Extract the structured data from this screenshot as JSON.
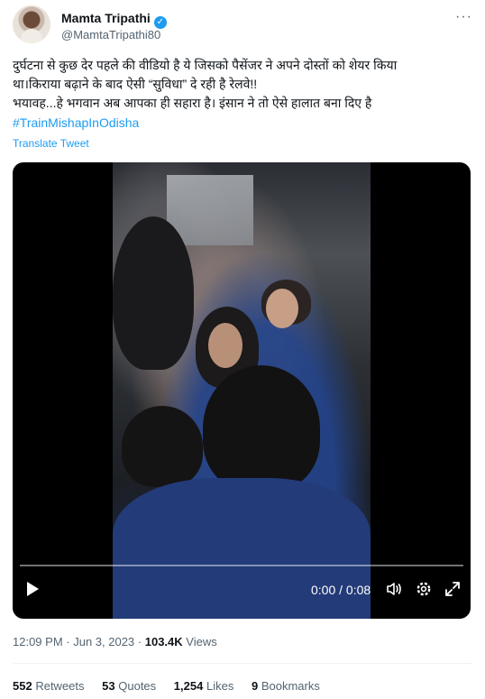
{
  "author": {
    "name": "Mamta Tripathi",
    "handle": "@MamtaTripathi80",
    "verified_badge": "✓"
  },
  "more_glyph": "···",
  "tweet": {
    "text": "दुर्घटना से कुछ देर पहले की वीडियो है ये जिसको पैसेंजर ने अपने दोस्तों को शेयर किया\nथा।किराया बढ़ाने के बाद ऐसी “सुविधा” दे रही है रेलवे!!\nभयावह...हे भगवान अब आपका ही सहारा है। इंसान ने तो ऐसे हालात बना दिए है",
    "hashtag": "#TrainMishapInOdisha",
    "translate": "Translate Tweet"
  },
  "video": {
    "time": "0:00 / 0:08",
    "progress": 0,
    "icons": [
      "play-icon",
      "volume-icon",
      "settings-icon",
      "fullscreen-icon"
    ]
  },
  "meta": {
    "time": "12:09 PM",
    "date": "Jun 3, 2023",
    "views_count": "103.4K",
    "views_label": "Views"
  },
  "stats": [
    {
      "count": "552",
      "label": "Retweets"
    },
    {
      "count": "53",
      "label": "Quotes"
    },
    {
      "count": "1,254",
      "label": "Likes"
    },
    {
      "count": "9",
      "label": "Bookmarks"
    }
  ],
  "colors": {
    "link": "#1d9bf0",
    "secondary_text": "#536471",
    "primary_text": "#0f1419"
  }
}
